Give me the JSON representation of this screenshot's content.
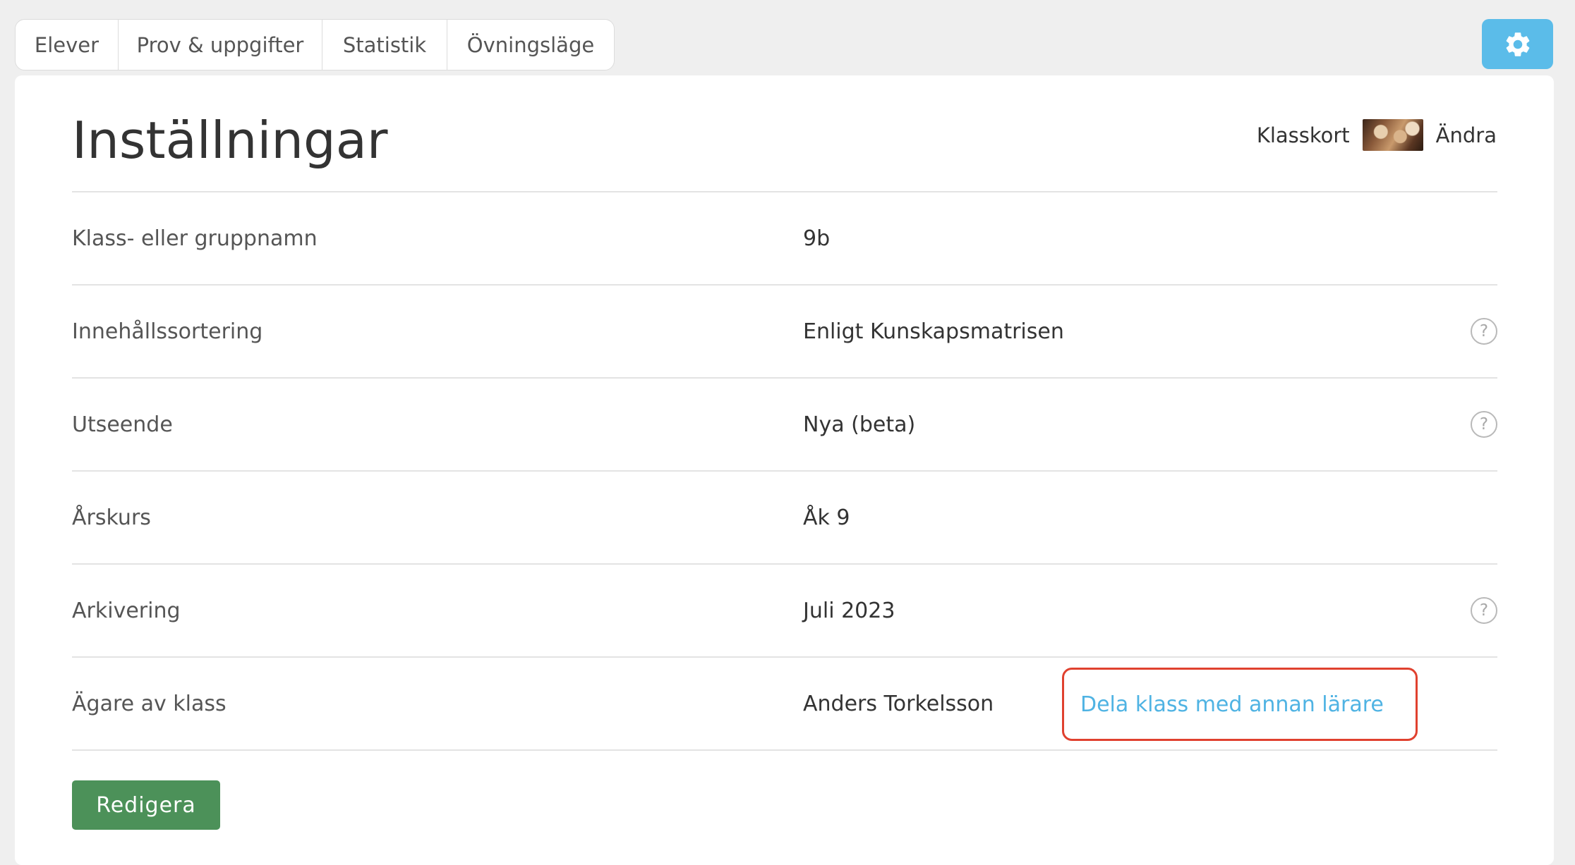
{
  "tabs": [
    {
      "label": "Elever"
    },
    {
      "label": "Prov & uppgifter"
    },
    {
      "label": "Statistik"
    },
    {
      "label": "Övningsläge"
    }
  ],
  "settings_button": {
    "icon": "gear-icon",
    "color": "#5bbce9"
  },
  "page": {
    "title": "Inställningar",
    "classcard_label": "Klasskort",
    "change_label": "Ändra"
  },
  "settings": [
    {
      "label": "Klass- eller gruppnamn",
      "value": "9b"
    },
    {
      "label": "Innehållssortering",
      "value": "Enligt Kunskapsmatrisen",
      "help": "?"
    },
    {
      "label": "Utseende",
      "value": "Nya (beta)",
      "help": "?"
    },
    {
      "label": "Årskurs",
      "value": "Åk 9"
    },
    {
      "label": "Arkivering",
      "value": "Juli 2023",
      "help": "?"
    },
    {
      "label": "Ägare av klass",
      "value": "Anders Torkelsson",
      "link": "Dela klass med annan lärare"
    }
  ],
  "edit_button": {
    "label": "Redigera",
    "color": "#4c9159"
  },
  "colors": {
    "link": "#4fb3e3",
    "highlight": "#e0412f"
  }
}
